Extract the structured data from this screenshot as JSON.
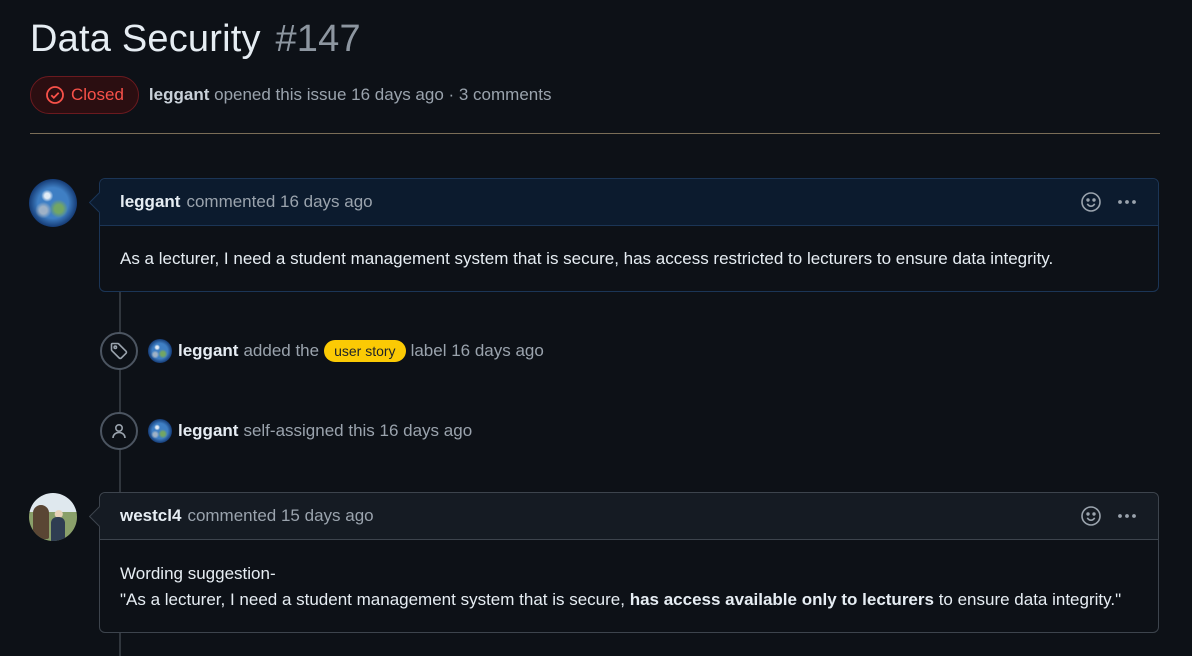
{
  "issue": {
    "title": "Data Security",
    "number": "#147",
    "state": "Closed",
    "author": "leggant",
    "opened_text": "opened this issue 16 days ago · 3 comments"
  },
  "colors": {
    "closed": "#f85149",
    "label_user_story": "#fbca04",
    "background": "#0d1117"
  },
  "comments": [
    {
      "author": "leggant",
      "action": "commented 16 days ago",
      "body": "As a lecturer, I need a student management system that is secure, has access restricted to lecturers to ensure data integrity.",
      "avatar": "earth-avatar"
    },
    {
      "author": "westcl4",
      "action": "commented 15 days ago",
      "body_line1": "Wording suggestion-",
      "body_pre": "\"As a lecturer, I need a student management system that is secure, ",
      "body_bold": "has access available only to lecturers",
      "body_post": " to ensure data integrity.\"",
      "avatar": "photo-avatar"
    }
  ],
  "events": [
    {
      "icon": "tag-icon",
      "actor": "leggant",
      "pre": "added the",
      "label": "user story",
      "post": "label 16 days ago"
    },
    {
      "icon": "person-icon",
      "actor": "leggant",
      "text": "self-assigned this 16 days ago"
    }
  ]
}
